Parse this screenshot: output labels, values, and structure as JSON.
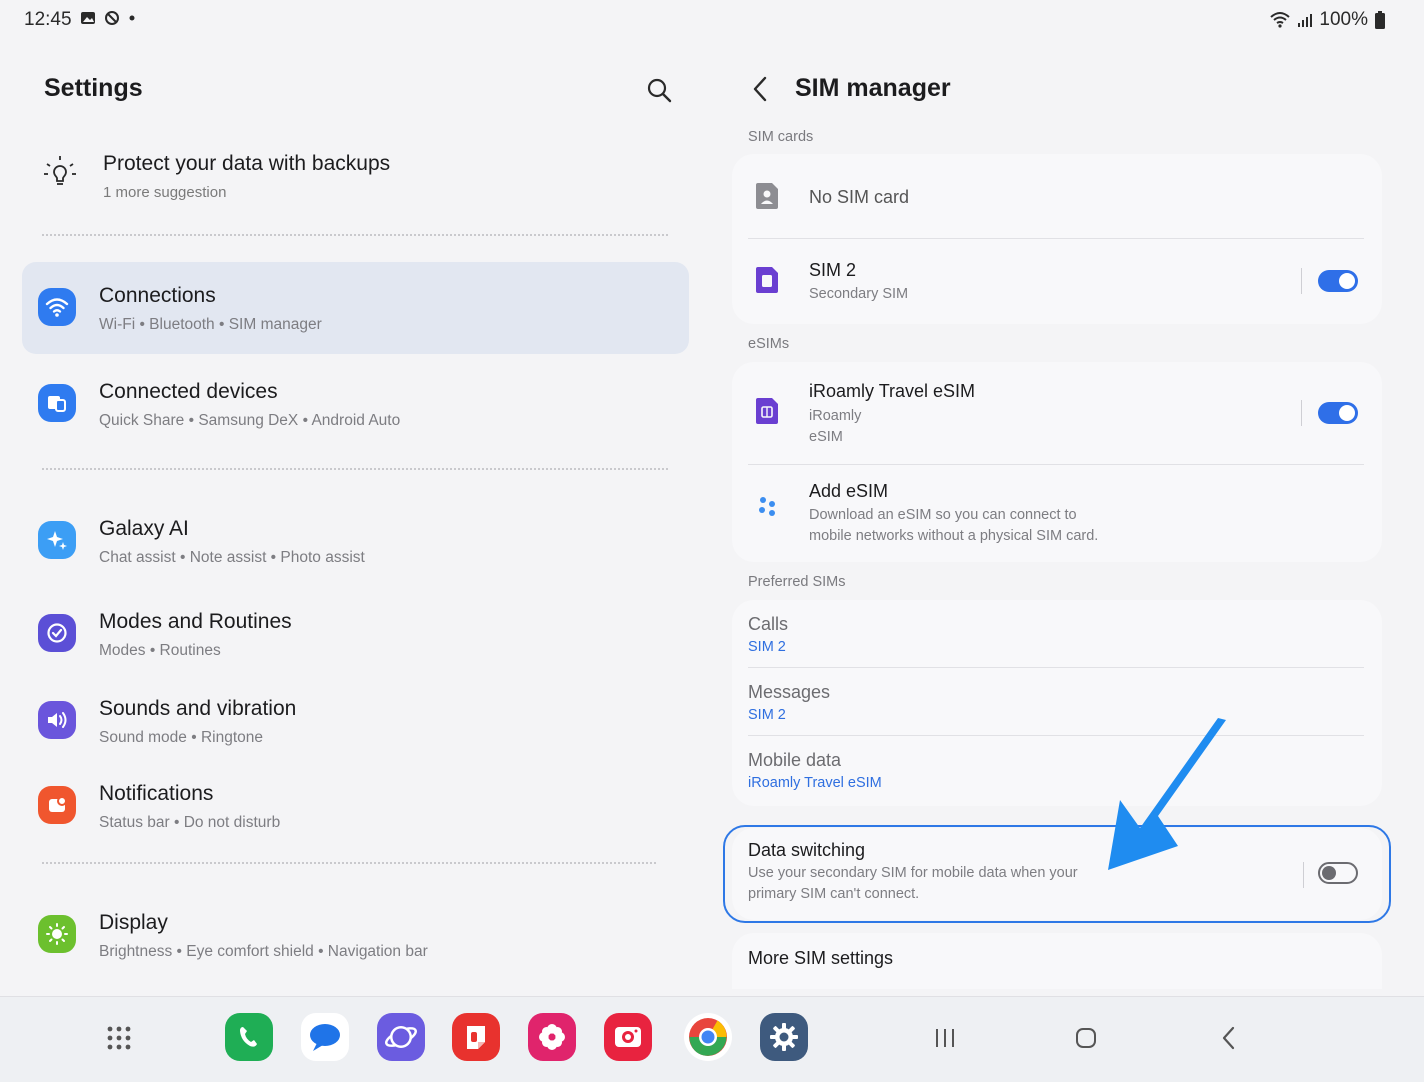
{
  "status_bar": {
    "time": "12:45",
    "battery": "100%"
  },
  "left_pane": {
    "title": "Settings",
    "suggestion": {
      "title": "Protect your data with backups",
      "subtitle": "1 more suggestion"
    },
    "items": [
      {
        "title": "Connections",
        "subtitle": "Wi-Fi  •  Bluetooth  •  SIM manager",
        "icon": "wifi-icon",
        "color": "#2f7bf0"
      },
      {
        "title": "Connected devices",
        "subtitle": "Quick Share  •  Samsung DeX  •  Android Auto",
        "icon": "devices-icon",
        "color": "#2f7bf0"
      },
      {
        "title": "Galaxy AI",
        "subtitle": "Chat assist  •  Note assist  •  Photo assist",
        "icon": "sparkle-icon",
        "color": "#3c9ef5"
      },
      {
        "title": "Modes and Routines",
        "subtitle": "Modes  •  Routines",
        "icon": "check-circle-icon",
        "color": "#5b4fd6"
      },
      {
        "title": "Sounds and vibration",
        "subtitle": "Sound mode  •  Ringtone",
        "icon": "speaker-icon",
        "color": "#6a55dc"
      },
      {
        "title": "Notifications",
        "subtitle": "Status bar  •  Do not disturb",
        "icon": "notification-icon",
        "color": "#f0562e"
      },
      {
        "title": "Display",
        "subtitle": "Brightness  •  Eye comfort shield  •  Navigation bar",
        "icon": "sun-icon",
        "color": "#6cc02e"
      }
    ]
  },
  "right_pane": {
    "title": "SIM manager",
    "sections": {
      "sim_cards": "SIM cards",
      "esims": "eSIMs",
      "preferred": "Preferred SIMs"
    },
    "sim_cards": [
      {
        "title": "No SIM card"
      },
      {
        "title": "SIM 2",
        "subtitle": "Secondary SIM",
        "enabled": true
      }
    ],
    "esims": [
      {
        "title": "iRoamly Travel eSIM",
        "subtitle1": "iRoamly",
        "subtitle2": "eSIM",
        "enabled": true
      },
      {
        "title": "Add eSIM",
        "subtitle1": "Download an eSIM so you can connect to",
        "subtitle2": "mobile networks without a physical SIM card."
      }
    ],
    "preferred": [
      {
        "title": "Calls",
        "value": "SIM 2"
      },
      {
        "title": "Messages",
        "value": "SIM 2"
      },
      {
        "title": "Mobile data",
        "value": "iRoamly Travel eSIM"
      }
    ],
    "data_switching": {
      "title": "Data switching",
      "desc1": "Use your secondary SIM for mobile data when your",
      "desc2": "primary SIM can't connect.",
      "enabled": false
    },
    "more": "More SIM settings"
  },
  "colors": {
    "accent": "#2f6fe8",
    "highlight": "#2e78e6"
  }
}
